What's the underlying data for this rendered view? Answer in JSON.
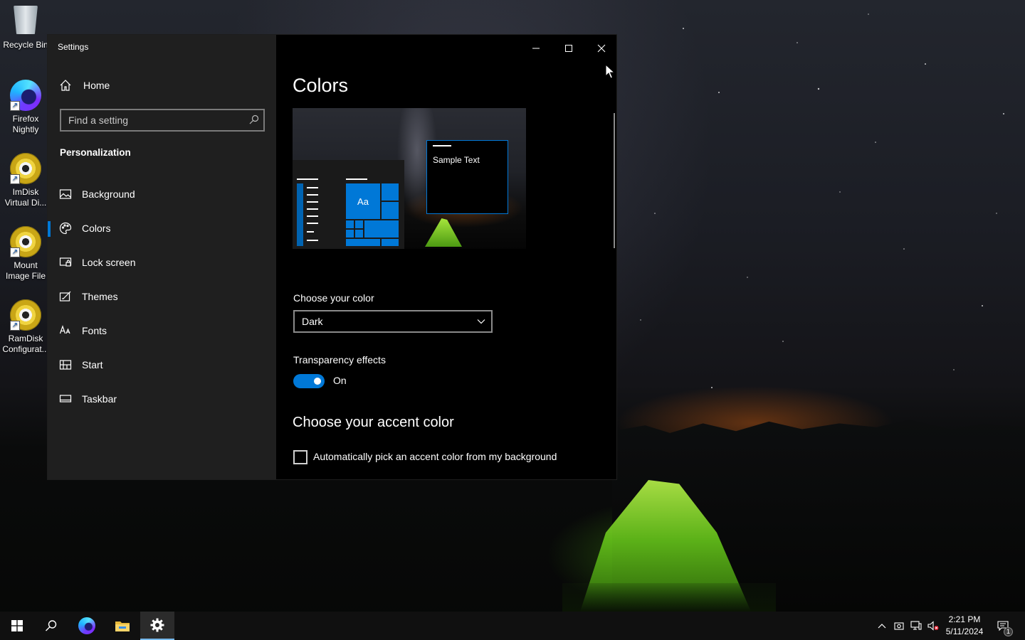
{
  "desktop": {
    "icons": [
      {
        "label": "Recycle Bin"
      },
      {
        "label": "Firefox Nightly"
      },
      {
        "label": "ImDisk Virtual Di..."
      },
      {
        "label": "Mount Image File"
      },
      {
        "label": "RamDisk Configurat..."
      }
    ]
  },
  "window": {
    "title": "Settings",
    "controls": {
      "minimize": "minimize-icon",
      "maximize": "maximize-icon",
      "close": "close-icon"
    }
  },
  "nav": {
    "home_label": "Home",
    "search_placeholder": "Find a setting",
    "section_title": "Personalization",
    "items": [
      {
        "label": "Background",
        "icon": "picture-icon"
      },
      {
        "label": "Colors",
        "icon": "palette-icon",
        "active": true
      },
      {
        "label": "Lock screen",
        "icon": "lock-screen-icon"
      },
      {
        "label": "Themes",
        "icon": "themes-icon"
      },
      {
        "label": "Fonts",
        "icon": "fonts-icon"
      },
      {
        "label": "Start",
        "icon": "start-icon"
      },
      {
        "label": "Taskbar",
        "icon": "taskbar-icon"
      }
    ]
  },
  "content": {
    "title": "Colors",
    "preview": {
      "tile_text": "Aa",
      "sample_text": "Sample Text"
    },
    "choose_color_label": "Choose your color",
    "choose_color_value": "Dark",
    "transparency_label": "Transparency effects",
    "transparency_state": "On",
    "accent_title": "Choose your accent color",
    "auto_accent_label": "Automatically pick an accent color from my background"
  },
  "taskbar": {
    "time": "2:21 PM",
    "date": "5/11/2024",
    "notification_count": "1"
  },
  "colors": {
    "accent": "#0078d7"
  }
}
